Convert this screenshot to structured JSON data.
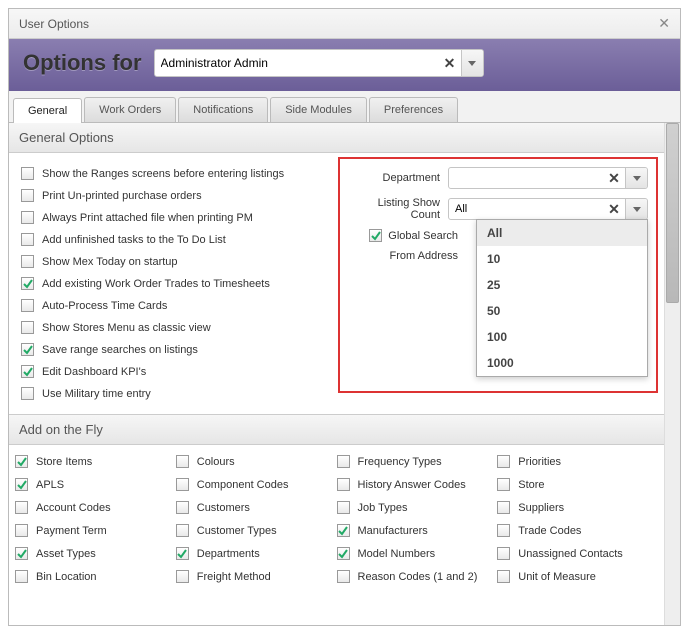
{
  "window": {
    "title": "User Options"
  },
  "header": {
    "label": "Options for",
    "user": "Administrator Admin"
  },
  "tabs": [
    "General",
    "Work Orders",
    "Notifications",
    "Side Modules",
    "Preferences"
  ],
  "activeTab": "General",
  "general": {
    "title": "General Options",
    "checks": [
      {
        "label": "Show the Ranges screens before entering listings",
        "checked": false
      },
      {
        "label": "Print Un-printed purchase orders",
        "checked": false
      },
      {
        "label": "Always Print attached file when printing PM",
        "checked": false
      },
      {
        "label": "Add unfinished tasks to the To Do List",
        "checked": false
      },
      {
        "label": "Show Mex Today on startup",
        "checked": false
      },
      {
        "label": "Add existing Work Order Trades to Timesheets",
        "checked": true
      },
      {
        "label": "Auto-Process Time Cards",
        "checked": false
      },
      {
        "label": "Show Stores Menu as classic view",
        "checked": false
      },
      {
        "label": "Save range searches on listings",
        "checked": true
      },
      {
        "label": "Edit Dashboard KPI's",
        "checked": true
      },
      {
        "label": "Use Military time entry",
        "checked": false
      }
    ],
    "right": {
      "department_label": "Department",
      "department_value": "",
      "listing_label": "Listing Show Count",
      "listing_value": "All",
      "global_label": "Global Search",
      "global_checked": true,
      "from_label": "From Address",
      "dropdown": [
        "All",
        "10",
        "25",
        "50",
        "100",
        "1000"
      ]
    }
  },
  "fly": {
    "title": "Add on the Fly",
    "cols": [
      [
        {
          "label": "Store Items",
          "checked": true
        },
        {
          "label": "APLS",
          "checked": true
        },
        {
          "label": "Account Codes",
          "checked": false
        },
        {
          "label": "Payment Term",
          "checked": false
        },
        {
          "label": "Asset Types",
          "checked": true
        },
        {
          "label": "Bin Location",
          "checked": false
        }
      ],
      [
        {
          "label": "Colours",
          "checked": false
        },
        {
          "label": "Component Codes",
          "checked": false
        },
        {
          "label": "Customers",
          "checked": false
        },
        {
          "label": "Customer Types",
          "checked": false
        },
        {
          "label": "Departments",
          "checked": true
        },
        {
          "label": "Freight Method",
          "checked": false
        }
      ],
      [
        {
          "label": "Frequency Types",
          "checked": false
        },
        {
          "label": "History Answer Codes",
          "checked": false
        },
        {
          "label": "Job Types",
          "checked": false
        },
        {
          "label": "Manufacturers",
          "checked": true
        },
        {
          "label": "Model Numbers",
          "checked": true
        },
        {
          "label": "Reason Codes (1 and 2)",
          "checked": false
        }
      ],
      [
        {
          "label": "Priorities",
          "checked": false
        },
        {
          "label": "Store",
          "checked": false
        },
        {
          "label": "Suppliers",
          "checked": false
        },
        {
          "label": "Trade Codes",
          "checked": false
        },
        {
          "label": "Unassigned Contacts",
          "checked": false
        },
        {
          "label": "Unit of Measure",
          "checked": false
        }
      ]
    ]
  }
}
